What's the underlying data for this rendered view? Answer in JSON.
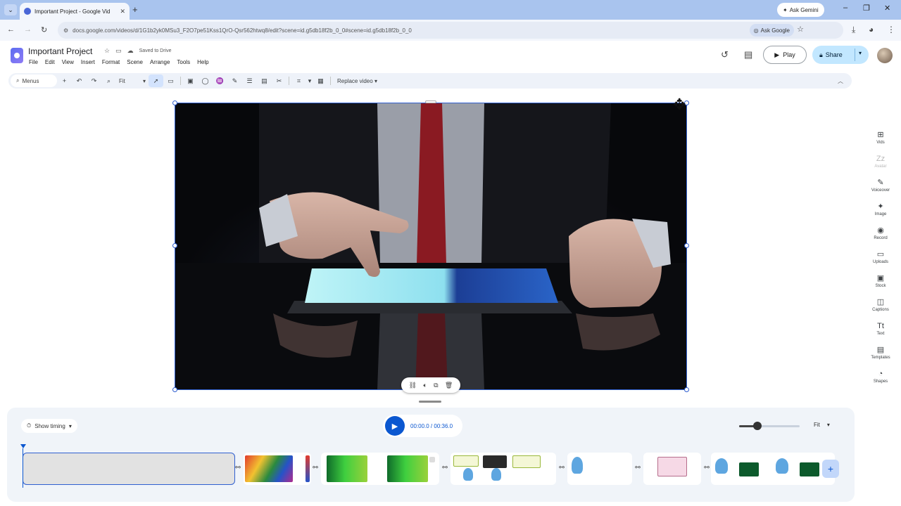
{
  "browser": {
    "tab_title": "Important Project - Google Vid",
    "tab_close": "✕",
    "new_tab": "+",
    "ask_gemini": "Ask Gemini",
    "url": "docs.google.com/videos/d/1G1b2yk0MSu3_F2O7pe51Kss1QrO-Qsr562htwq8/edit?scene=id.g5db18f2b_0_0#scene=id.g5db18f2b_0_0",
    "ask_google": "Ask Google",
    "window_controls": [
      "–",
      "❐",
      "✕"
    ]
  },
  "app": {
    "title": "Important Project",
    "saved_status": "Saved to Drive",
    "menu": [
      "File",
      "Edit",
      "View",
      "Insert",
      "Format",
      "Scene",
      "Arrange",
      "Tools",
      "Help"
    ],
    "play_label": "Play",
    "share_label": "Share"
  },
  "toolbar": {
    "menus_label": "Menus",
    "fit_label": "Fit",
    "replace_label": "Replace video"
  },
  "right_rail": [
    {
      "label": "Vids",
      "icon": "layout-icon",
      "glyph": "⊞",
      "disabled": false
    },
    {
      "label": "Avatar",
      "icon": "avatar-icon",
      "glyph": "Zz",
      "disabled": true
    },
    {
      "label": "Voiceover",
      "icon": "voiceover-icon",
      "glyph": "✎",
      "disabled": false
    },
    {
      "label": "Image",
      "icon": "image-icon",
      "glyph": "✦",
      "disabled": false
    },
    {
      "label": "Record",
      "icon": "record-icon",
      "glyph": "◉",
      "disabled": false
    },
    {
      "label": "Uploads",
      "icon": "folder-icon",
      "glyph": "▭",
      "disabled": false
    },
    {
      "label": "Stock",
      "icon": "stock-icon",
      "glyph": "▣",
      "disabled": false
    },
    {
      "label": "Captions",
      "icon": "captions-icon",
      "glyph": "◫",
      "disabled": false
    },
    {
      "label": "Text",
      "icon": "text-icon",
      "glyph": "Tt",
      "disabled": false
    },
    {
      "label": "Templates",
      "icon": "templates-icon",
      "glyph": "▤",
      "disabled": false
    },
    {
      "label": "Shapes",
      "icon": "shapes-icon",
      "glyph": "◔",
      "disabled": false
    }
  ],
  "timeline": {
    "show_timing_label": "Show timing",
    "current_time": "00:00.0",
    "total_time": "00:36.0",
    "time_separator": " / ",
    "zoom_level": 0.3,
    "fit_label": "Fit"
  },
  "colors": {
    "accent": "#0b57d0",
    "share_bg": "#c2e7ff",
    "selection": "#2f5fd0"
  }
}
